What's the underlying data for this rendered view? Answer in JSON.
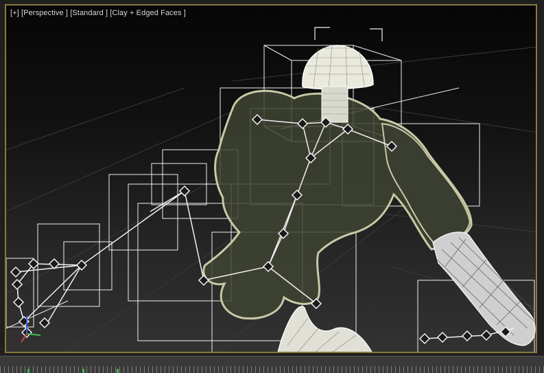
{
  "viewport": {
    "label_plus": "[+]",
    "label_view": "[Perspective ]",
    "label_shading": "[Standard ]",
    "label_mode": "[Clay + Edged Faces ]"
  },
  "colors": {
    "frame_active": "#8a7a3a",
    "wireframe": "#ffffff",
    "mesh_fill": "#3f4433",
    "mesh_edge": "#c9c9a6",
    "bone_nodes": "#f2f2f2"
  },
  "icons": {
    "axis_gizmo": "axis-gizmo-icon"
  }
}
